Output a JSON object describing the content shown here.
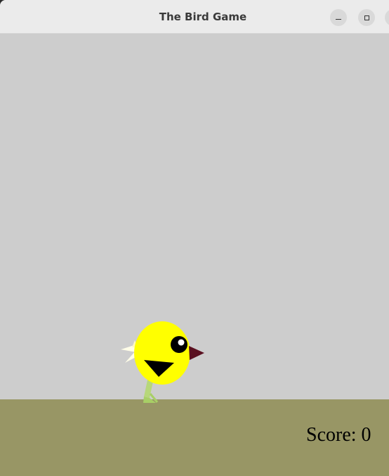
{
  "window": {
    "title": "The Bird Game",
    "controls": {
      "minimize_icon": "minimize-icon",
      "maximize_icon": "maximize-icon",
      "close_icon": "close-icon"
    }
  },
  "game": {
    "sky_color": "#cdcdcd",
    "ground_color": "#989665",
    "bird_color": "#ffff00",
    "score_text": "Score: 0"
  }
}
